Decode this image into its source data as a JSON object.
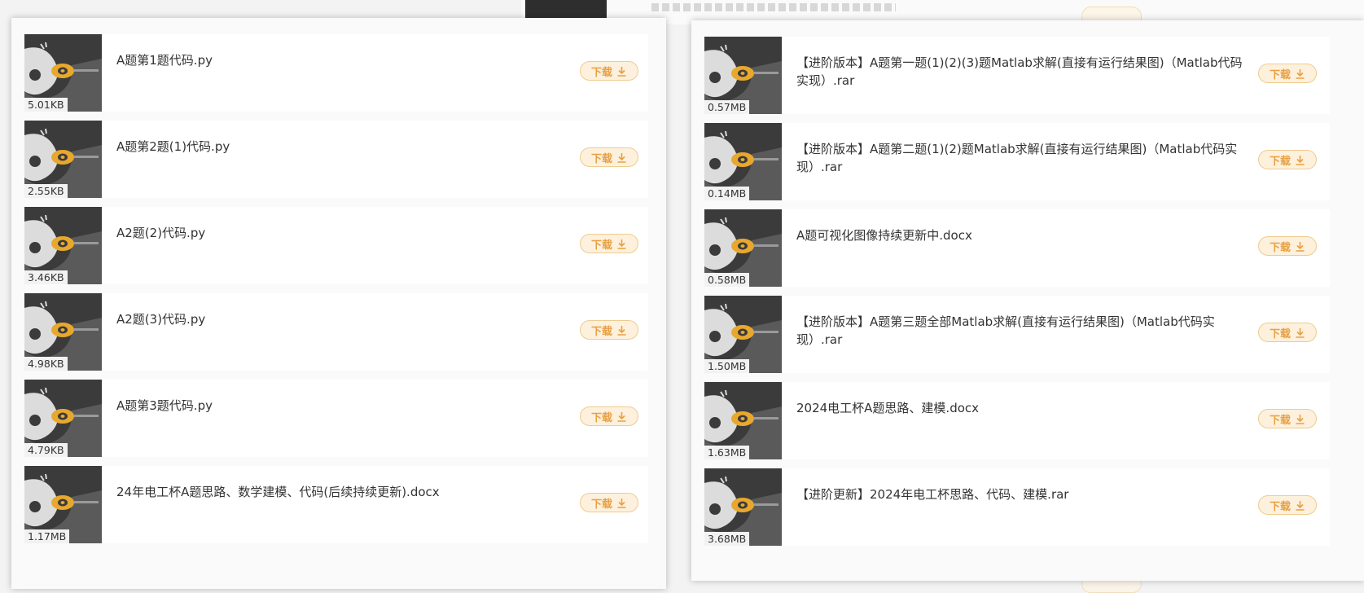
{
  "colors": {
    "accent": "#e8a043",
    "button_bg": "#fdf1dd",
    "button_border": "#eecb8f",
    "thumb_bg": "#3b3b3b",
    "logo_ring": "#e8a82e"
  },
  "download_label": "下载",
  "download_icon": "download-arrow-icon",
  "left_list": [
    {
      "name": "A题第1题代码.py",
      "size": "5.01KB"
    },
    {
      "name": "A题第2题(1)代码.py",
      "size": "2.55KB"
    },
    {
      "name": "A2题(2)代码.py",
      "size": "3.46KB"
    },
    {
      "name": "A2题(3)代码.py",
      "size": "4.98KB"
    },
    {
      "name": "A题第3题代码.py",
      "size": "4.79KB"
    },
    {
      "name": "24年电工杯A题思路、数学建模、代码(后续持续更新).docx",
      "size": "1.17MB"
    }
  ],
  "right_list": [
    {
      "name": "【进阶版本】A题第一题(1)(2)(3)题Matlab求解(直接有运行结果图)（Matlab代码实现）.rar",
      "size": "0.57MB"
    },
    {
      "name": "【进阶版本】A题第二题(1)(2)题Matlab求解(直接有运行结果图)（Matlab代码实现）.rar",
      "size": "0.14MB"
    },
    {
      "name": "A题可视化图像持续更新中.docx",
      "size": "0.58MB"
    },
    {
      "name": "【进阶版本】A题第三题全部Matlab求解(直接有运行结果图)（Matlab代码实现）.rar",
      "size": "1.50MB"
    },
    {
      "name": "2024电工杯A题思路、建模.docx",
      "size": "1.63MB"
    },
    {
      "name": "【进阶更新】2024年电工杯思路、代码、建模.rar",
      "size": "3.68MB"
    }
  ]
}
